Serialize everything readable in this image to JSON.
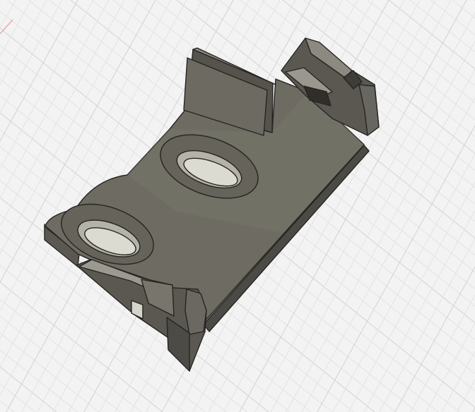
{
  "colors": {
    "background": "#f3f3f3",
    "grid_minor": "#e3e3e3",
    "grid_major": "#d2d2d2",
    "axis_red": "#e98b8b",
    "part_top": "#6f6d63",
    "part_top_light": "#7a786e",
    "part_side": "#5d5b53",
    "part_side_dark": "#47453f",
    "part_edge": "#262522",
    "slot_wall": "#b7b5ab",
    "slot_floor": "#d9d8cf"
  },
  "scene": {
    "view": "3d-perspective",
    "object": "mounting-bracket",
    "slots": 2,
    "tabs": 1,
    "clips": 2
  }
}
